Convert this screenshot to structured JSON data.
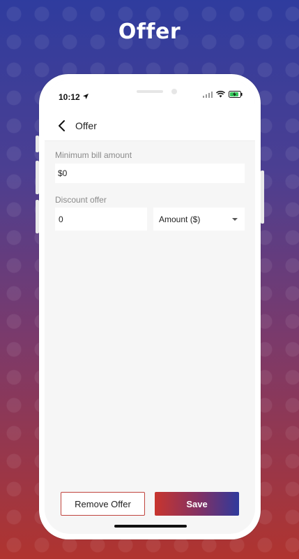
{
  "headline": "Offer",
  "status": {
    "time": "10:12"
  },
  "nav": {
    "title": "Offer"
  },
  "form": {
    "min_bill_label": "Minimum bill amount",
    "min_bill_value": "$0",
    "discount_label": "Discount offer",
    "discount_value": "0",
    "discount_type_selected": "Amount ($)"
  },
  "buttons": {
    "remove": "Remove Offer",
    "save": "Save"
  },
  "colors": {
    "accent_red": "#c8352e",
    "accent_blue": "#2f3a9c"
  },
  "icons": {
    "back": "chevron-left-icon",
    "location": "location-arrow-icon",
    "signal": "signal-icon",
    "wifi": "wifi-icon",
    "battery": "battery-charging-icon"
  }
}
